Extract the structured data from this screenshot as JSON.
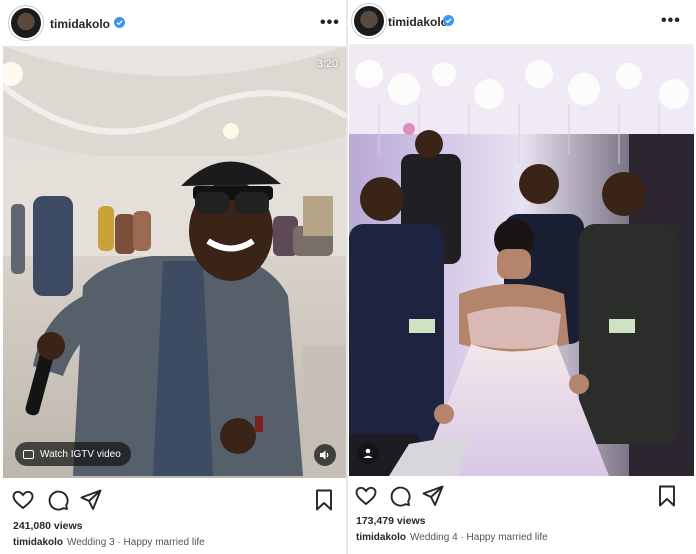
{
  "posts": [
    {
      "username": "timidakolo",
      "verified": true,
      "more_label": "•••",
      "video_duration": "3:20",
      "igtv_label": "Watch IGTV video",
      "views": "241,080 views",
      "caption_user": "timidakolo",
      "caption_text": "Wedding 3 · Happy married life",
      "icons": [
        "heart-icon",
        "comment-icon",
        "share-icon",
        "bookmark-icon",
        "tv-icon",
        "volume-icon"
      ]
    },
    {
      "username": "timidakolo",
      "verified": true,
      "more_label": "•••",
      "views": "173,479 views",
      "caption_user": "timidakolo",
      "caption_text": "Wedding 4 · Happy married life",
      "icons": [
        "heart-icon",
        "comment-icon",
        "share-icon",
        "bookmark-icon",
        "tag-icon"
      ]
    }
  ],
  "colors": {
    "verified": "#3897f0",
    "text": "#262626",
    "muted": "#555555"
  }
}
